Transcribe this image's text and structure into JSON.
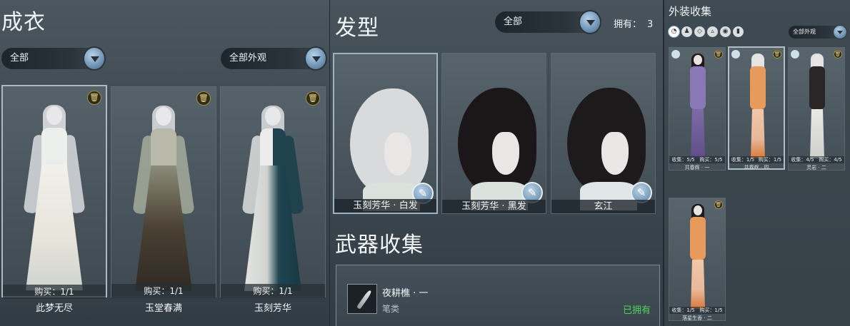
{
  "outfits": {
    "title": "成衣",
    "filter1": "全部",
    "filter2": "全部外观",
    "items": [
      {
        "name": "此梦无尽",
        "buy": "购买：1/1",
        "selected": true
      },
      {
        "name": "玉堂春满",
        "buy": "购买：1/1",
        "selected": false
      },
      {
        "name": "玉刻芳华",
        "buy": "购买：1/1",
        "selected": false
      }
    ]
  },
  "hairstyle": {
    "title": "发型",
    "filter": "全部",
    "owned_label": "拥有：",
    "owned_count": "3",
    "items": [
      {
        "name": "玉刻芳华 · 白发",
        "color": "#d7d9db",
        "selected": true
      },
      {
        "name": "玉刻芳华 · 黑发",
        "color": "#1b1718",
        "selected": false
      },
      {
        "name": "玄江",
        "color": "#1d1a1b",
        "selected": false
      }
    ]
  },
  "weapons": {
    "title": "武器收集",
    "item": {
      "name": "夜耕樵 · 一",
      "type": "笔类",
      "status": "已拥有"
    }
  },
  "collection": {
    "title": "外装收集",
    "filter": "全部外观",
    "categories": [
      "hair-category-icon",
      "outfit-category-icon",
      "accessory-category-icon",
      "cloak-category-icon",
      "face-category-icon",
      "pendant-category-icon"
    ],
    "items": [
      {
        "name": "共春辉 · 一",
        "collect": "收集：5/5",
        "buy": "购买：5/5",
        "selected": false
      },
      {
        "name": "共春辉 · 四",
        "collect": "收集：1/5",
        "buy": "购买：1/5",
        "selected": true
      },
      {
        "name": "灵岩 · 二",
        "collect": "收集：4/5",
        "buy": "购买：4/5",
        "selected": false
      },
      {
        "name": "落星生香 · 二",
        "collect": "收集：1/5",
        "buy": "购买：1/5",
        "selected": false
      }
    ]
  }
}
